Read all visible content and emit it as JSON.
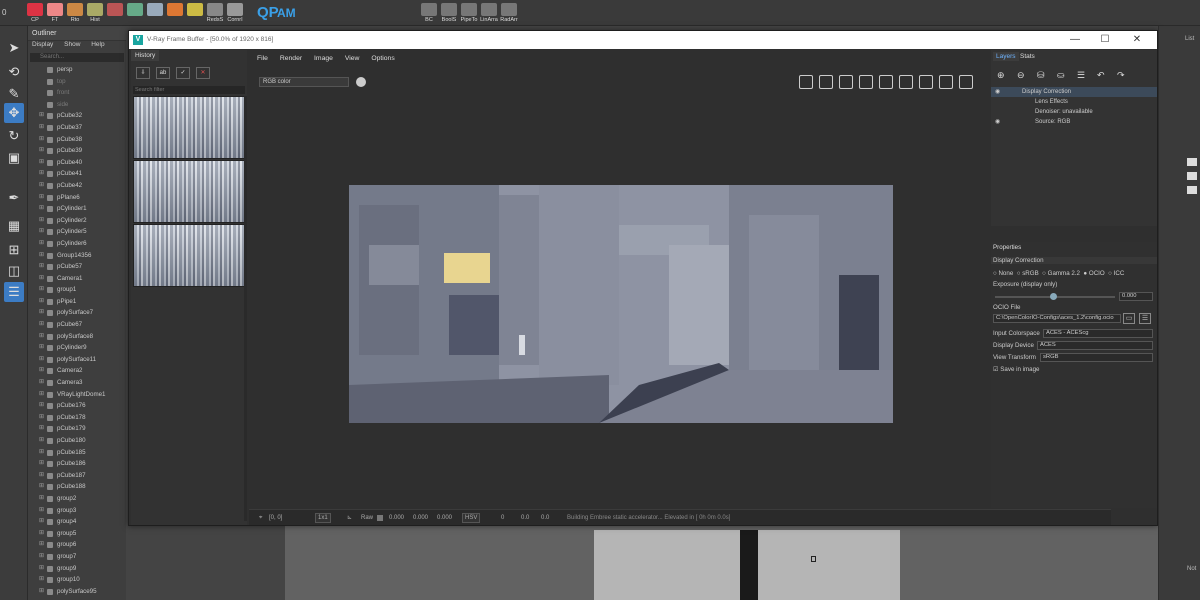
{
  "shelf": {
    "num_label": "0",
    "buttons": [
      "CP",
      "FT",
      "Rto",
      "Hist",
      "",
      "",
      "",
      "",
      "",
      "RedsS",
      "CornrI"
    ],
    "qp_label": "QP",
    "am_label": "AM",
    "buttons2": [
      "BC",
      "BoolS",
      "PipeTo",
      "LinArra",
      "RadArr"
    ]
  },
  "outliner": {
    "title": "Outliner",
    "menu": [
      "Display",
      "Show",
      "Help"
    ],
    "search_placeholder": "Search...",
    "items": [
      {
        "label": "persp",
        "dim": false
      },
      {
        "label": "top",
        "dim": true
      },
      {
        "label": "front",
        "dim": true
      },
      {
        "label": "side",
        "dim": true
      },
      {
        "label": "pCube32",
        "dim": false
      },
      {
        "label": "pCube37",
        "dim": false
      },
      {
        "label": "pCube38",
        "dim": false
      },
      {
        "label": "pCube39",
        "dim": false
      },
      {
        "label": "pCube40",
        "dim": false
      },
      {
        "label": "pCube41",
        "dim": false
      },
      {
        "label": "pCube42",
        "dim": false
      },
      {
        "label": "pPlane6",
        "dim": false
      },
      {
        "label": "pCylinder1",
        "dim": false
      },
      {
        "label": "pCylinder2",
        "dim": false
      },
      {
        "label": "pCylinder5",
        "dim": false
      },
      {
        "label": "pCylinder6",
        "dim": false
      },
      {
        "label": "Group14356",
        "dim": false
      },
      {
        "label": "pCube57",
        "dim": false
      },
      {
        "label": "Camera1",
        "dim": false
      },
      {
        "label": "group1",
        "dim": false
      },
      {
        "label": "pPipe1",
        "dim": false
      },
      {
        "label": "polySurface7",
        "dim": false
      },
      {
        "label": "pCube67",
        "dim": false
      },
      {
        "label": "polySurface8",
        "dim": false
      },
      {
        "label": "pCylinder9",
        "dim": false
      },
      {
        "label": "polySurface11",
        "dim": false
      },
      {
        "label": "Camera2",
        "dim": false
      },
      {
        "label": "Camera3",
        "dim": false
      },
      {
        "label": "VRayLightDome1",
        "dim": false
      },
      {
        "label": "pCube176",
        "dim": false
      },
      {
        "label": "pCube178",
        "dim": false
      },
      {
        "label": "pCube179",
        "dim": false
      },
      {
        "label": "pCube180",
        "dim": false
      },
      {
        "label": "pCube185",
        "dim": false
      },
      {
        "label": "pCube186",
        "dim": false
      },
      {
        "label": "pCube187",
        "dim": false
      },
      {
        "label": "pCube188",
        "dim": false
      },
      {
        "label": "group2",
        "dim": false
      },
      {
        "label": "group3",
        "dim": false
      },
      {
        "label": "group4",
        "dim": false
      },
      {
        "label": "group5",
        "dim": false
      },
      {
        "label": "group6",
        "dim": false
      },
      {
        "label": "group7",
        "dim": false
      },
      {
        "label": "group9",
        "dim": false
      },
      {
        "label": "group10",
        "dim": false
      },
      {
        "label": "polySurface95",
        "dim": false
      }
    ]
  },
  "vfb": {
    "title": "V-Ray Frame Buffer - [50.0% of 1920 x 816]",
    "history_tab": "History",
    "history_search": "Search filter",
    "menu": [
      "File",
      "Render",
      "Image",
      "View",
      "Options"
    ],
    "channel": "RGB color",
    "bottom": {
      "coords": "[0, 0]",
      "ratio": "1x1",
      "raw_label": "Raw",
      "values": [
        "0.000",
        "0.000",
        "0.000"
      ],
      "mode": "HSV",
      "hsv": [
        "0",
        "0.0",
        "0.0"
      ],
      "status": "Building Embree static accelerator... Elevated in [ 0h 0m 0.0s]"
    }
  },
  "layers": {
    "tabs": [
      "Layers",
      "Stats"
    ],
    "rows": [
      "Display Correction",
      "Lens Effects",
      "Denoiser: unavailable",
      "Source: RGB"
    ]
  },
  "properties": {
    "title": "Properties",
    "section": "Display Correction",
    "modes": [
      "None",
      "sRGB",
      "Gamma 2.2",
      "OCIO",
      "ICC"
    ],
    "selected_mode": "OCIO",
    "exposure_label": "Exposure (display only)",
    "exposure_value": "0.000",
    "ocio_label": "OCIO File",
    "ocio_path": "C:\\OpenColorIO-Configs\\aces_1.2\\config.ocio",
    "input_label": "Input Colorspace",
    "input_value": "ACES - ACEScg",
    "device_label": "Display Device",
    "device_value": "ACES",
    "view_label": "View Transform",
    "view_value": "sRGB",
    "save_label": "Save in image"
  },
  "rightstrip": {
    "label_top": "List",
    "label_bottom": "Not"
  },
  "colors": {
    "accent": "#3c7cc4",
    "vray": "#19a5a0"
  }
}
